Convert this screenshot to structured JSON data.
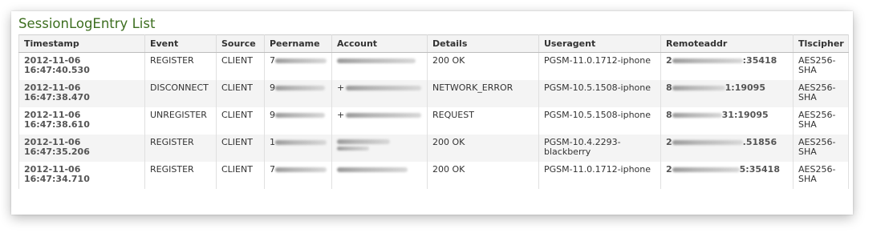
{
  "page": {
    "title": "SessionLogEntry List"
  },
  "table": {
    "columns": [
      "Timestamp",
      "Event",
      "Source",
      "Peername",
      "Account",
      "Details",
      "Useragent",
      "Remoteaddr",
      "Tlscipher"
    ],
    "rows": [
      {
        "timestamp": "2012-11-06 16:47:40.530",
        "event": "REGISTER",
        "source": "CLIENT",
        "peername_prefix": "7",
        "account_prefix": "",
        "details": "200 OK",
        "useragent": "PGSM-11.0.1712-iphone",
        "remote_prefix": "2",
        "remote_suffix": ":35418",
        "tlscipher": "AES256-SHA"
      },
      {
        "timestamp": "2012-11-06 16:47:38.470",
        "event": "DISCONNECT",
        "source": "CLIENT",
        "peername_prefix": "9",
        "account_prefix": "+",
        "details": "NETWORK_ERROR",
        "useragent": "PGSM-10.5.1508-iphone",
        "remote_prefix": "8",
        "remote_suffix": "1:19095",
        "tlscipher": "AES256-SHA"
      },
      {
        "timestamp": "2012-11-06 16:47:38.610",
        "event": "UNREGISTER",
        "source": "CLIENT",
        "peername_prefix": "9",
        "account_prefix": "+",
        "details": "REQUEST",
        "useragent": "PGSM-10.5.1508-iphone",
        "remote_prefix": "8",
        "remote_suffix": "31:19095",
        "tlscipher": "AES256-SHA"
      },
      {
        "timestamp": "2012-11-06 16:47:35.206",
        "event": "REGISTER",
        "source": "CLIENT",
        "peername_prefix": "1",
        "account_prefix": "",
        "details": "200 OK",
        "useragent": "PGSM-10.4.2293-blackberry",
        "remote_prefix": "2",
        "remote_suffix": ".51856",
        "tlscipher": "AES256-SHA"
      },
      {
        "timestamp": "2012-11-06 16:47:34.710",
        "event": "REGISTER",
        "source": "CLIENT",
        "peername_prefix": "7",
        "account_prefix": "",
        "details": "200 OK",
        "useragent": "PGSM-11.0.1712-iphone",
        "remote_prefix": "2",
        "remote_suffix": "5:35418",
        "tlscipher": "AES256-SHA"
      }
    ]
  },
  "colors": {
    "title": "#3d6e1f",
    "header_bg": "#f3f3f3",
    "row_alt_bg": "#f4f4f4",
    "text": "#333333"
  }
}
